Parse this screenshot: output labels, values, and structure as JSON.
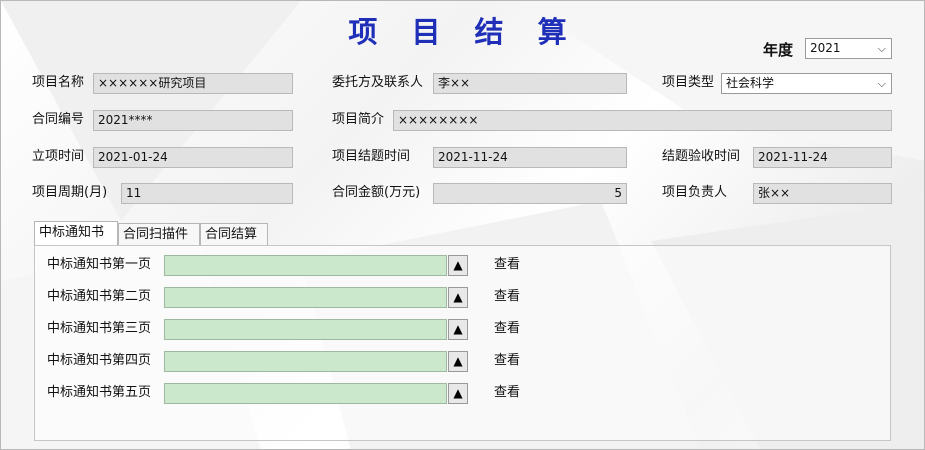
{
  "title": "项 目 结 算",
  "year": {
    "label": "年度",
    "value": "2021"
  },
  "fields": {
    "project_name": {
      "label": "项目名称",
      "value": "××××××研究项目"
    },
    "client": {
      "label": "委托方及联系人",
      "value": "李××"
    },
    "project_type": {
      "label": "项目类型",
      "value": "社会科学"
    },
    "contract_no": {
      "label": "合同编号",
      "value": "2021****"
    },
    "summary": {
      "label": "项目简介",
      "value": "××××××××"
    },
    "start_date": {
      "label": "立项时间",
      "value": "2021-01-24"
    },
    "close_date": {
      "label": "项目结题时间",
      "value": "2021-11-24"
    },
    "accept_date": {
      "label": "结题验收时间",
      "value": "2021-11-24"
    },
    "period": {
      "label": "项目周期(月)",
      "value": "11"
    },
    "amount": {
      "label": "合同金额(万元)",
      "value": "5"
    },
    "leader": {
      "label": "项目负责人",
      "value": "张××"
    }
  },
  "tabs": [
    "中标通知书",
    "合同扫描件",
    "合同结算"
  ],
  "attachments": [
    {
      "label": "中标通知书第一页",
      "upload": "▲",
      "view": "查看"
    },
    {
      "label": "中标通知书第二页",
      "upload": "▲",
      "view": "查看"
    },
    {
      "label": "中标通知书第三页",
      "upload": "▲",
      "view": "查看"
    },
    {
      "label": "中标通知书第四页",
      "upload": "▲",
      "view": "查看"
    },
    {
      "label": "中标通知书第五页",
      "upload": "▲",
      "view": "查看"
    }
  ],
  "colors": {
    "title": "#1f2fb8",
    "attachment_field": "#cbe8cd",
    "readonly_field": "#e1e1e1"
  }
}
